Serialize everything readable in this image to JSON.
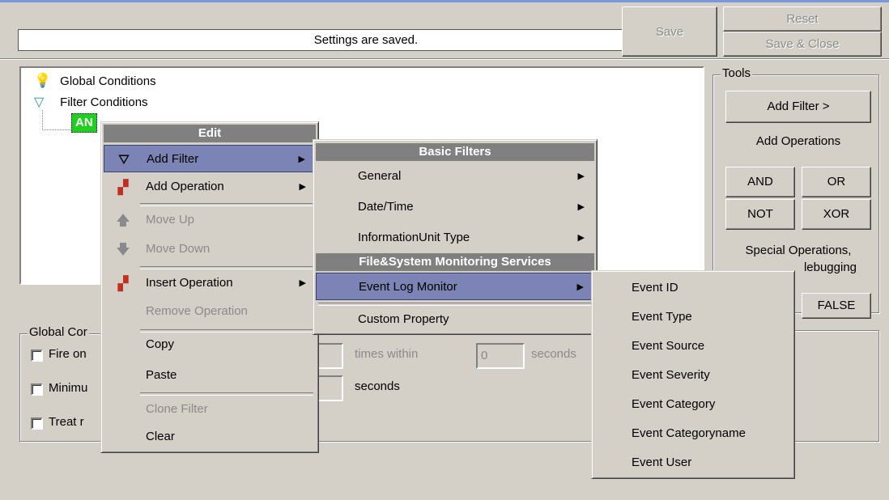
{
  "status_text": "Settings are saved.",
  "buttons": {
    "save": "Save",
    "reset": "Reset",
    "save_close": "Save & Close"
  },
  "tree": {
    "items": [
      {
        "label": "Global Conditions",
        "icon": "lightbulb-icon"
      },
      {
        "label": "Filter Conditions",
        "icon": "funnel-icon"
      },
      {
        "label": "AN",
        "icon": ""
      }
    ]
  },
  "tools": {
    "title": "Tools",
    "add_filter": "Add Filter >",
    "add_operations": "Add Operations",
    "and": "AND",
    "or": "OR",
    "not": "NOT",
    "xor": "XOR",
    "special_line1": "Special Operations,",
    "special_line2": "lebugging",
    "false": "FALSE"
  },
  "global": {
    "title": "Global Cor",
    "rows": [
      "Fire on",
      "Minimu",
      "Treat r"
    ],
    "times_within": "times within",
    "seconds_value": "0",
    "seconds1": "seconds",
    "seconds2": "seconds"
  },
  "edit_menu": {
    "header": "Edit",
    "items": [
      {
        "label": "Add Filter",
        "submenu": true,
        "highlighted": true
      },
      {
        "label": "Add Operation",
        "submenu": true
      },
      {
        "label": "Move Up",
        "disabled": true
      },
      {
        "label": "Move Down",
        "disabled": true
      },
      {
        "label": "Insert Operation",
        "submenu": true
      },
      {
        "label": "Remove Operation",
        "disabled": true
      },
      {
        "label": "Copy"
      },
      {
        "label": "Paste"
      },
      {
        "label": "Clone Filter",
        "disabled": true
      },
      {
        "label": "Clear"
      }
    ]
  },
  "filter_menu": {
    "header1": "Basic Filters",
    "header2": "File&System Monitoring Services",
    "items": [
      "General",
      "Date/Time",
      "InformationUnit Type",
      "Event Log Monitor",
      "Custom Property"
    ]
  },
  "event_menu": {
    "items": [
      "Event ID",
      "Event Type",
      "Event Source",
      "Event Severity",
      "Event Category",
      "Event Categoryname",
      "Event User"
    ]
  },
  "colors": {
    "highlight": "#7b84b5",
    "header": "#808080",
    "green": "#1fd01f"
  }
}
